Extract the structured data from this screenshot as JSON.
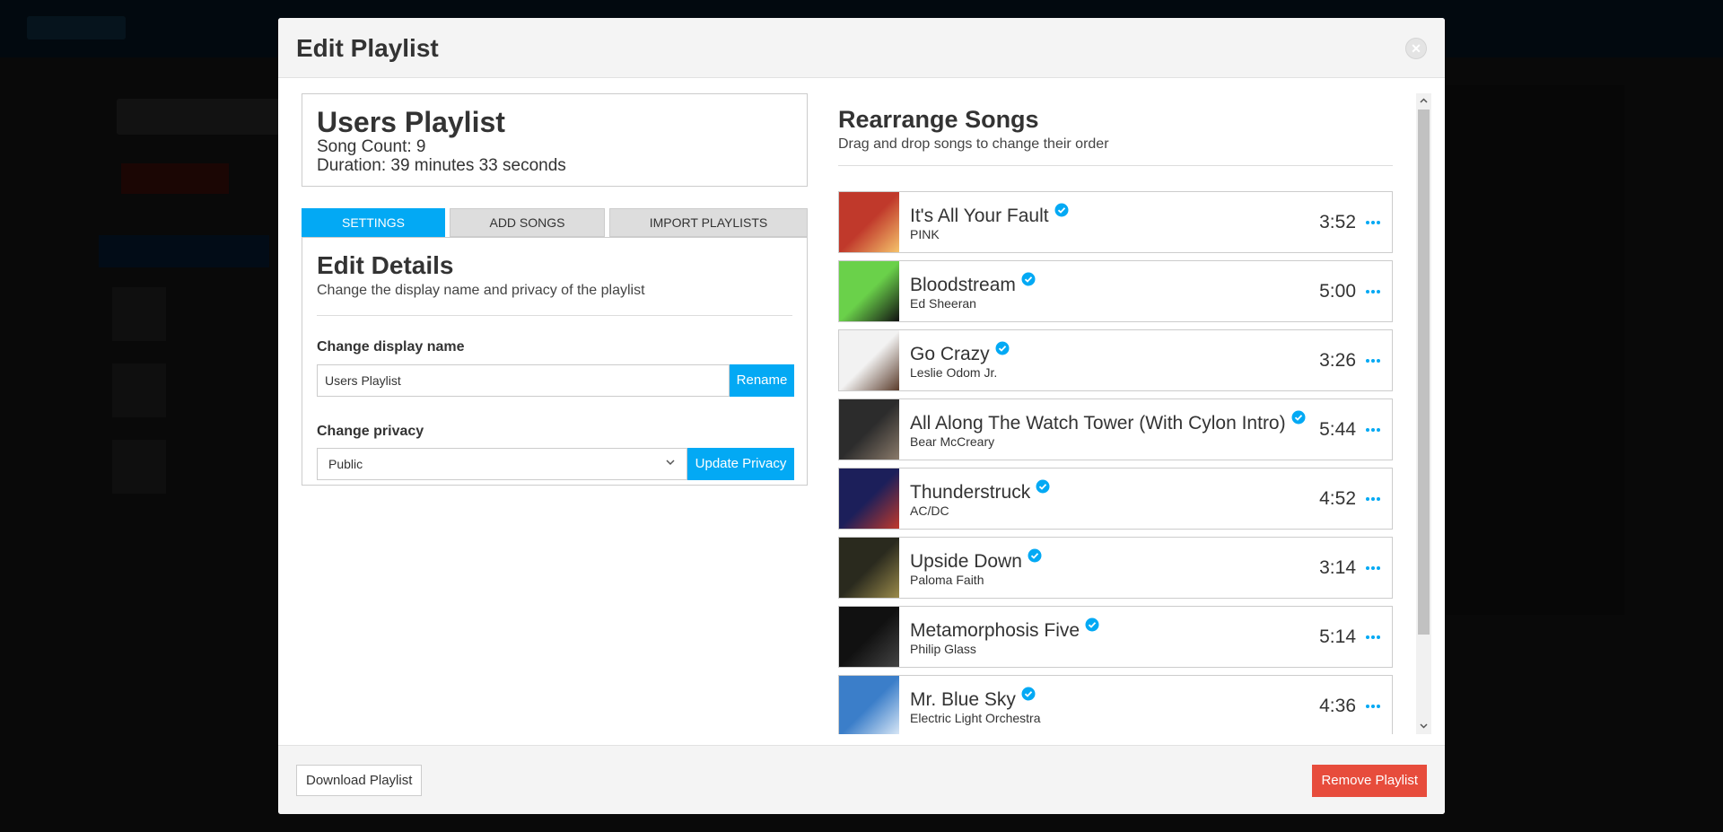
{
  "modal": {
    "title": "Edit Playlist",
    "close_icon": "times-icon"
  },
  "playlist": {
    "name": "Users Playlist",
    "song_count": "Song Count: 9",
    "duration": "Duration: 39 minutes 33 seconds"
  },
  "tabs": [
    {
      "label": "SETTINGS",
      "active": true
    },
    {
      "label": "ADD SONGS",
      "active": false
    },
    {
      "label": "IMPORT PLAYLISTS",
      "active": false
    }
  ],
  "settings": {
    "title": "Edit Details",
    "subtitle": "Change the display name and privacy of the playlist",
    "name_label": "Change display name",
    "name_value": "Users Playlist",
    "rename_label": "Rename",
    "privacy_label": "Change privacy",
    "privacy_value": "Public",
    "update_privacy_label": "Update Privacy"
  },
  "rearrange": {
    "title": "Rearrange Songs",
    "subtitle": "Drag and drop songs to change their order",
    "songs": [
      {
        "title": "It's All Your Fault",
        "artist": "PINK",
        "duration": "3:52",
        "art_colors": [
          "#c0392b",
          "#f5c36b"
        ]
      },
      {
        "title": "Bloodstream",
        "artist": "Ed Sheeran",
        "duration": "5:00",
        "art_colors": [
          "#6ad14a",
          "#111111"
        ]
      },
      {
        "title": "Go Crazy",
        "artist": "Leslie Odom Jr.",
        "duration": "3:26",
        "art_colors": [
          "#f2f2f2",
          "#5a3b2a"
        ]
      },
      {
        "title": "All Along The Watch Tower (With Cylon Intro)",
        "artist": "Bear McCreary",
        "duration": "5:44",
        "art_colors": [
          "#2c2c2c",
          "#8a7a6a"
        ]
      },
      {
        "title": "Thunderstruck",
        "artist": "AC/DC",
        "duration": "4:52",
        "art_colors": [
          "#1c1f5a",
          "#c0392b"
        ]
      },
      {
        "title": "Upside Down",
        "artist": "Paloma Faith",
        "duration": "3:14",
        "art_colors": [
          "#2a2a1e",
          "#9a8a4a"
        ]
      },
      {
        "title": "Metamorphosis Five",
        "artist": "Philip Glass",
        "duration": "5:14",
        "art_colors": [
          "#111111",
          "#444444"
        ]
      },
      {
        "title": "Mr. Blue Sky",
        "artist": "Electric Light Orchestra",
        "duration": "4:36",
        "art_colors": [
          "#3b7ec9",
          "#dbe9f7"
        ]
      }
    ]
  },
  "footer": {
    "download_label": "Download Playlist",
    "remove_label": "Remove Playlist"
  },
  "colors": {
    "accent": "#03a9f4",
    "danger": "#e74c3c"
  }
}
